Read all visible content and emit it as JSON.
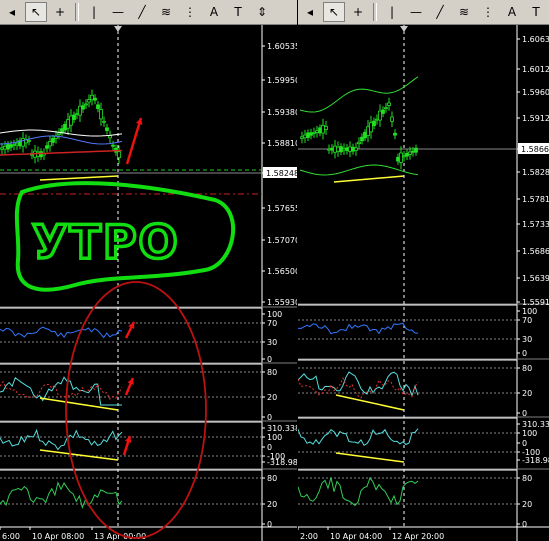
{
  "left": {
    "toolbar": [
      {
        "name": "collapse-arrow-icon",
        "glyph": "◂"
      },
      {
        "name": "cursor-tool-button",
        "glyph": "↖",
        "active": true
      },
      {
        "name": "crosshair-tool-button",
        "glyph": "+"
      },
      {
        "sep": true
      },
      {
        "name": "vertical-line-button",
        "glyph": "|"
      },
      {
        "name": "horizontal-line-button",
        "glyph": "—"
      },
      {
        "name": "trendline-button",
        "glyph": "╱"
      },
      {
        "name": "fibonacci-button",
        "glyph": "≋"
      },
      {
        "name": "fibo-expansion-button",
        "glyph": "⋮"
      },
      {
        "name": "text-button",
        "glyph": "A"
      },
      {
        "name": "text-label-button",
        "glyph": "T"
      },
      {
        "name": "arrows-button",
        "glyph": "⇕"
      }
    ],
    "price_labels": [
      "1.60535",
      "1.59950",
      "1.59380",
      "1.58810",
      "1.58248",
      "1.57655",
      "1.57070",
      "1.56500",
      "1.55930"
    ],
    "current_price": "1.58248",
    "rsi_labels": [
      "100",
      "70",
      "30",
      "0"
    ],
    "stoch_labels": [
      "80",
      "20",
      "0"
    ],
    "cci_labels": [
      "310.338",
      "100",
      "0",
      "-100",
      "-318.980"
    ],
    "last_labels": [
      "80",
      "20",
      "0"
    ],
    "time_labels": [
      "6:00",
      "10 Apr 08:00",
      "13 Apr 00:00"
    ],
    "annotation": "УТРО"
  },
  "right": {
    "toolbar": [
      {
        "name": "collapse-arrow-icon",
        "glyph": "◂"
      },
      {
        "name": "cursor-tool-button",
        "glyph": "↖",
        "active": true
      },
      {
        "name": "crosshair-tool-button",
        "glyph": "+"
      },
      {
        "sep": true
      },
      {
        "name": "vertical-line-button",
        "glyph": "|"
      },
      {
        "name": "horizontal-line-button",
        "glyph": "—"
      },
      {
        "name": "trendline-button",
        "glyph": "╱"
      },
      {
        "name": "fibonacci-button",
        "glyph": "≋"
      },
      {
        "name": "fibo-expansion-button",
        "glyph": "⋮"
      },
      {
        "name": "text-button",
        "glyph": "A"
      },
      {
        "name": "text-label-button",
        "glyph": "T"
      }
    ],
    "price_labels": [
      "1.60630",
      "1.60120",
      "1.59600",
      "1.59120",
      "1.58667",
      "1.58280",
      "1.57810",
      "1.57330",
      "1.56860",
      "1.56390",
      "1.55910"
    ],
    "current_price": "1.58667",
    "rsi_labels": [
      "100",
      "70",
      "30",
      "0"
    ],
    "stoch_labels": [
      "80",
      "20",
      "0"
    ],
    "cci_labels": [
      "310.3387",
      "100",
      "0",
      "-100",
      "-318.980"
    ],
    "last_labels": [
      "80",
      "20",
      "0"
    ],
    "time_labels": [
      "2:00",
      "10 Apr 04:00",
      "12 Apr 20:00"
    ]
  }
}
